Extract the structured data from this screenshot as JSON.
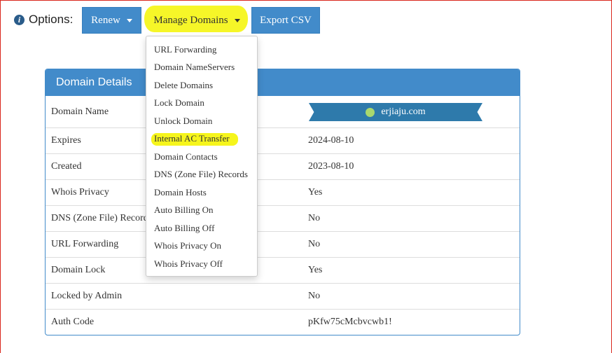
{
  "options": {
    "label": "Options:",
    "info_icon": "info-icon"
  },
  "toolbar": {
    "renew_label": "Renew",
    "manage_label": "Manage Domains",
    "export_label": "Export CSV"
  },
  "menu": {
    "items": [
      "URL Forwarding",
      "Domain NameServers",
      "Delete Domains",
      "Lock Domain",
      "Unlock Domain",
      "Internal AC Transfer",
      "Domain Contacts",
      "DNS (Zone File) Records",
      "Domain Hosts",
      "Auto Billing On",
      "Auto Billing Off",
      "Whois Privacy On",
      "Whois Privacy Off"
    ],
    "highlighted_item": "Internal AC Transfer"
  },
  "panel": {
    "title": "Domain Details",
    "domain_name_label": "Domain Name",
    "domain_name_value": "erjiaju.com",
    "status_dot_color": "#a9d86e",
    "rows": [
      {
        "label": "Expires",
        "value": "2024-08-10"
      },
      {
        "label": "Created",
        "value": "2023-08-10"
      },
      {
        "label": "Whois Privacy",
        "value": "Yes"
      },
      {
        "label": "DNS (Zone File) Records",
        "value": "No"
      },
      {
        "label": "URL Forwarding",
        "value": "No"
      },
      {
        "label": "Domain Lock",
        "value": "Yes"
      },
      {
        "label": "Locked by Admin",
        "value": "No"
      },
      {
        "label": "Auth Code",
        "value": "pKfw75cMcbvcwb1!"
      }
    ]
  },
  "colors": {
    "accent": "#428bca",
    "highlight": "#f6f51c",
    "ribbon": "#2e7aab",
    "frame": "#d9261c"
  }
}
